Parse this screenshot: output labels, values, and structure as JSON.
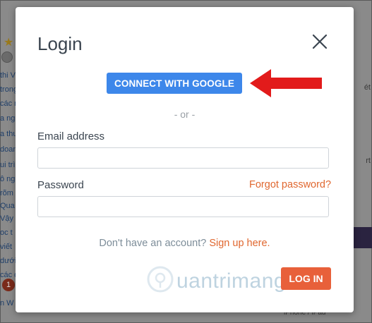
{
  "background": {
    "left_snippets": [
      "thi V",
      "trong",
      "các n",
      "a ng",
      "a thu",
      "doan",
      "ui trì",
      "ô ng",
      "rõm",
      "Qua",
      "Vậy",
      "oc t",
      "viết",
      "dưới",
      "các d",
      "n W"
    ],
    "right_snippets": [
      "ét",
      "rt"
    ],
    "badge": "1",
    "bottom_texts": [
      "iPhone / iPad"
    ]
  },
  "modal": {
    "title": "Login",
    "google_button": "CONNECT WITH GOOGLE",
    "or_divider": "- or -",
    "email_label": "Email address",
    "email_value": "",
    "password_label": "Password",
    "password_value": "",
    "forgot_password": "Forgot password?",
    "no_account_text": "Don't have an account?",
    "signup_link": "Sign up here.",
    "login_button": "LOG IN"
  },
  "watermark": {
    "text": "uantrimang"
  },
  "colors": {
    "google_blue": "#3d87ea",
    "accent_orange": "#e0672f",
    "arrow_red": "#e21b1b"
  }
}
